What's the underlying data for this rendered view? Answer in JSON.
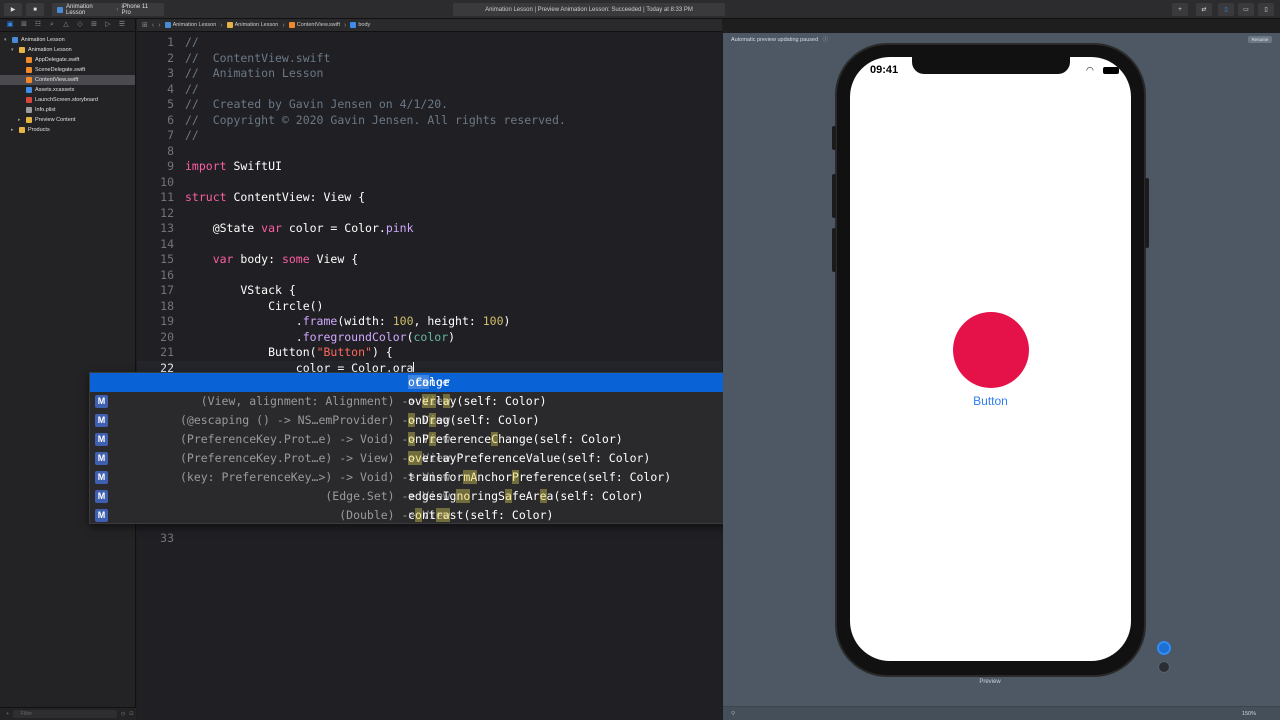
{
  "toolbar": {
    "scheme_target": "Animation Lesson",
    "scheme_device": "iPhone 11 Pro",
    "status": "Animation Lesson | Preview Animation Lesson: Succeeded | Today at 8:33 PM"
  },
  "navigator": {
    "items": [
      {
        "label": "Animation Lesson",
        "kind": "proj",
        "indent": 0,
        "disclosure": "▾"
      },
      {
        "label": "Animation Lesson",
        "kind": "folder",
        "indent": 1,
        "disclosure": "▾"
      },
      {
        "label": "AppDelegate.swift",
        "kind": "swift",
        "indent": 2,
        "disclosure": ""
      },
      {
        "label": "SceneDelegate.swift",
        "kind": "swift",
        "indent": 2,
        "disclosure": ""
      },
      {
        "label": "ContentView.swift",
        "kind": "swift",
        "indent": 2,
        "disclosure": "",
        "selected": true
      },
      {
        "label": "Assets.xcassets",
        "kind": "asset",
        "indent": 2,
        "disclosure": ""
      },
      {
        "label": "LaunchScreen.storyboard",
        "kind": "sb",
        "indent": 2,
        "disclosure": ""
      },
      {
        "label": "Info.plist",
        "kind": "plist",
        "indent": 2,
        "disclosure": ""
      },
      {
        "label": "Preview Content",
        "kind": "folder",
        "indent": 2,
        "disclosure": "▸"
      },
      {
        "label": "Products",
        "kind": "folder",
        "indent": 1,
        "disclosure": "▸"
      }
    ],
    "filter_placeholder": "Filter"
  },
  "jumpbar": {
    "crumbs": [
      "Animation Lesson",
      "Animation Lesson",
      "ContentView.swift",
      "body"
    ]
  },
  "code": {
    "lines": [
      {
        "n": "1",
        "segs": [
          {
            "t": "//",
            "c": "cm"
          }
        ]
      },
      {
        "n": "2",
        "segs": [
          {
            "t": "//  ContentView.swift",
            "c": "cm"
          }
        ]
      },
      {
        "n": "3",
        "segs": [
          {
            "t": "//  Animation Lesson",
            "c": "cm"
          }
        ]
      },
      {
        "n": "4",
        "segs": [
          {
            "t": "//",
            "c": "cm"
          }
        ]
      },
      {
        "n": "5",
        "segs": [
          {
            "t": "//  Created by Gavin Jensen on 4/1/20.",
            "c": "cm"
          }
        ]
      },
      {
        "n": "6",
        "segs": [
          {
            "t": "//  Copyright © 2020 Gavin Jensen. All rights reserved.",
            "c": "cm"
          }
        ]
      },
      {
        "n": "7",
        "segs": [
          {
            "t": "//",
            "c": "cm"
          }
        ]
      },
      {
        "n": "8",
        "segs": []
      },
      {
        "n": "9",
        "segs": [
          {
            "t": "import",
            "c": "kw"
          },
          {
            "t": " SwiftUI",
            "c": ""
          }
        ]
      },
      {
        "n": "10",
        "segs": []
      },
      {
        "n": "11",
        "segs": [
          {
            "t": "struct",
            "c": "kw"
          },
          {
            "t": " ContentView: View {",
            "c": ""
          }
        ]
      },
      {
        "n": "12",
        "segs": []
      },
      {
        "n": "13",
        "segs": [
          {
            "t": "    @State ",
            "c": ""
          },
          {
            "t": "var",
            "c": "kw"
          },
          {
            "t": " color = Color.",
            "c": ""
          },
          {
            "t": "pink",
            "c": "ty"
          }
        ]
      },
      {
        "n": "14",
        "segs": []
      },
      {
        "n": "15",
        "segs": [
          {
            "t": "    ",
            "c": ""
          },
          {
            "t": "var",
            "c": "kw"
          },
          {
            "t": " body: ",
            "c": ""
          },
          {
            "t": "some",
            "c": "kw"
          },
          {
            "t": " View {",
            "c": ""
          }
        ]
      },
      {
        "n": "16",
        "segs": []
      },
      {
        "n": "17",
        "segs": [
          {
            "t": "        VStack {",
            "c": ""
          }
        ]
      },
      {
        "n": "18",
        "segs": [
          {
            "t": "            Circle()",
            "c": ""
          }
        ]
      },
      {
        "n": "19",
        "segs": [
          {
            "t": "                .",
            "c": ""
          },
          {
            "t": "frame",
            "c": "ty"
          },
          {
            "t": "(width: ",
            "c": ""
          },
          {
            "t": "100",
            "c": "nu"
          },
          {
            "t": ", height: ",
            "c": ""
          },
          {
            "t": "100",
            "c": "nu"
          },
          {
            "t": ")",
            "c": ""
          }
        ]
      },
      {
        "n": "20",
        "segs": [
          {
            "t": "                .",
            "c": ""
          },
          {
            "t": "foregroundColor",
            "c": "ty"
          },
          {
            "t": "(",
            "c": ""
          },
          {
            "t": "color",
            "c": "pr"
          },
          {
            "t": ")",
            "c": ""
          }
        ]
      },
      {
        "n": "21",
        "segs": [
          {
            "t": "            Button(",
            "c": ""
          },
          {
            "t": "\"Button\"",
            "c": "st"
          },
          {
            "t": ") {",
            "c": ""
          }
        ]
      },
      {
        "n": "22",
        "segs": [
          {
            "t": "                color = Color.ora",
            "c": ""
          }
        ],
        "current": true
      },
      {
        "n": "33",
        "segs": []
      }
    ]
  },
  "completion": {
    "items": [
      {
        "ret": "Color",
        "name": "orange",
        "hl": "ora",
        "selected": true,
        "badge": ""
      },
      {
        "ret": "(View, alignment: Alignment) -> View",
        "name": "overlay(self: Color)",
        "badge": "M"
      },
      {
        "ret": "(@escaping () -> NS…emProvider) -> View",
        "name": "onDrag(self: Color)",
        "badge": "M"
      },
      {
        "ret": "(PreferenceKey.Prot…e) -> Void) -> View",
        "name": "onPreferenceChange(self: Color)",
        "badge": "M"
      },
      {
        "ret": "(PreferenceKey.Prot…e) -> View) -> View",
        "name": "overlayPreferenceValue(self: Color)",
        "badge": "M"
      },
      {
        "ret": "(key: PreferenceKey…>) -> Void) -> View",
        "name": "transformAnchorPreference(self: Color)",
        "badge": "M"
      },
      {
        "ret": "(Edge.Set) -> View",
        "name": "edgesIgnoringSafeArea(self: Color)",
        "badge": "M"
      },
      {
        "ret": "(Double) -> View",
        "name": "contrast(self: Color)",
        "badge": "M"
      }
    ]
  },
  "canvas": {
    "header": "Automatic preview updating paused",
    "resume": "Resume",
    "preview_label": "Preview",
    "zoom": "150%"
  },
  "device": {
    "time": "09:41",
    "button_label": "Button",
    "circle_color": "#e5124a"
  }
}
